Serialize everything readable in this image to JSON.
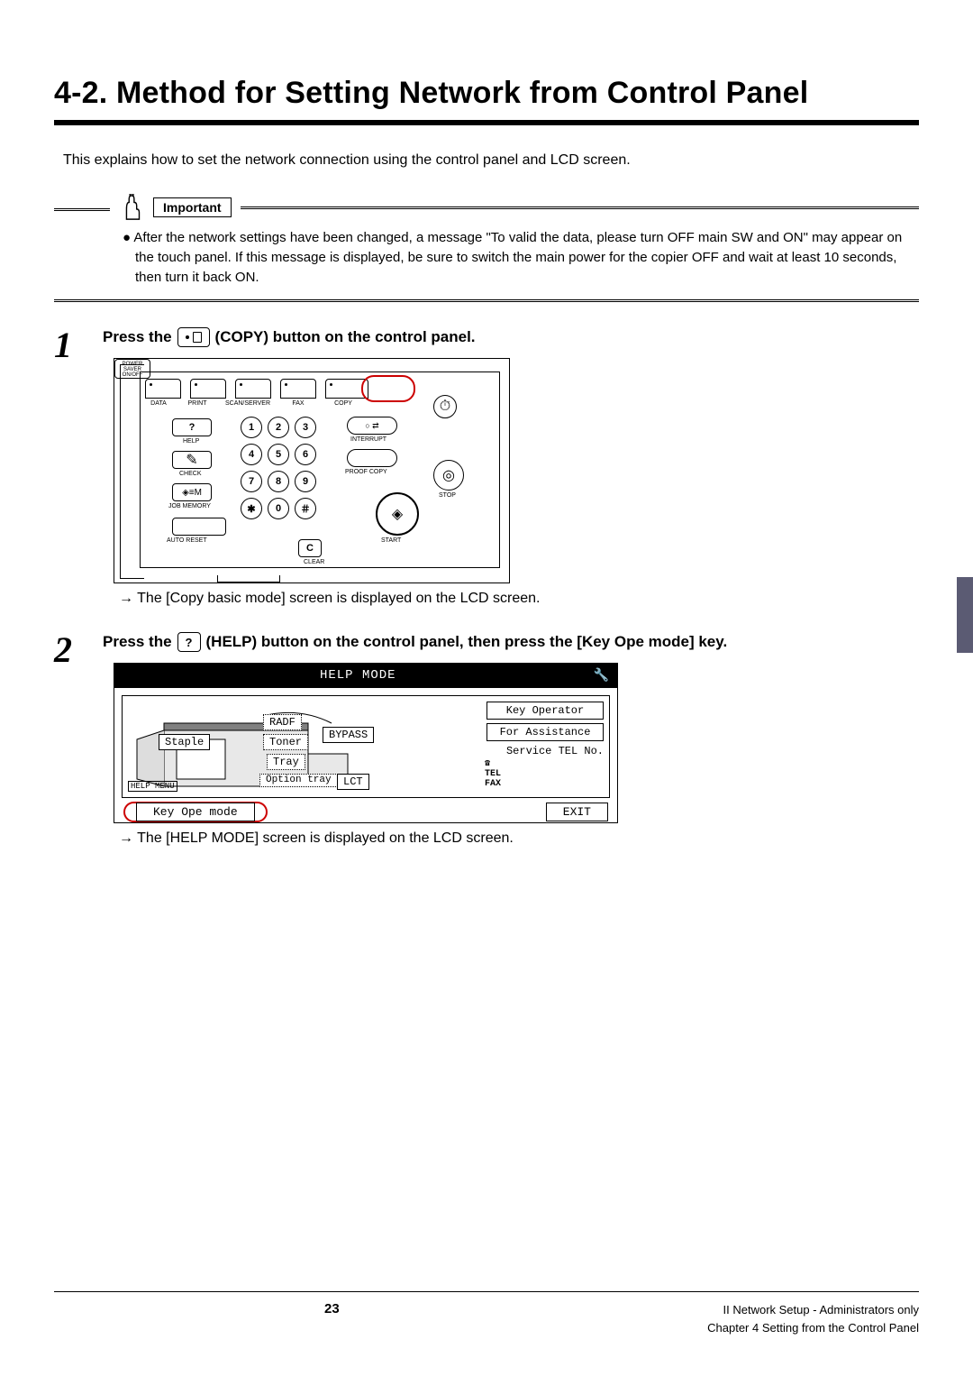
{
  "title": "4-2. Method for Setting Network from Control Panel",
  "intro": "This explains how to set the network connection using the control panel and LCD screen.",
  "important": {
    "label": "Important",
    "text": "After the network settings have been changed, a message \"To valid the data, please turn OFF main SW and ON\" may appear on the touch panel. If this message is displayed, be sure to switch the main power for the copier OFF and wait at least 10 seconds, then turn it back ON."
  },
  "step1": {
    "num": "1",
    "lead": "Press the",
    "btn_name": "COPY",
    "tail": "(COPY) button on the control panel.",
    "result": "The [Copy basic mode] screen is displayed on the LCD screen."
  },
  "panel": {
    "tabs": {
      "data": "DATA",
      "print": "PRINT",
      "scan": "SCAN/SERVER",
      "fax": "FAX",
      "copy": "COPY"
    },
    "labels": {
      "help": "HELP",
      "check": "CHECK",
      "job": "JOB MEMORY",
      "reset": "AUTO RESET",
      "interrupt": "INTERRUPT",
      "proof": "PROOF COPY",
      "start": "START",
      "stop": "STOP",
      "clear": "CLEAR",
      "power": "POWER SAVER\nON/OFF"
    },
    "keys": [
      "1",
      "2",
      "3",
      "4",
      "5",
      "6",
      "7",
      "8",
      "9",
      "✱",
      "0",
      "＃"
    ],
    "help_glyph": "?",
    "c_key": "C"
  },
  "step2": {
    "num": "2",
    "lead": "Press the",
    "tail_a": "(HELP) button on the control panel, then press the [Key Ope mode] key.",
    "result": "The [HELP MODE] screen is displayed on the LCD screen."
  },
  "lcd": {
    "title": "HELP MODE",
    "staple": "Staple",
    "radf": "RADF",
    "toner": "Toner",
    "bypass": "BYPASS",
    "tray": "Tray",
    "option": "Option tray",
    "lct": "LCT",
    "help_menu": "HELP MENU",
    "key_operator": "Key Operator",
    "for_assistance": "For Assistance",
    "service_tel": "Service TEL No.",
    "tel": "TEL",
    "fax": "FAX",
    "key_ope_mode": "Key Ope mode",
    "exit": "EXIT"
  },
  "footer": {
    "page": "23",
    "right1": "II Network Setup - Administrators only",
    "right2": "Chapter 4 Setting from the Control Panel"
  }
}
